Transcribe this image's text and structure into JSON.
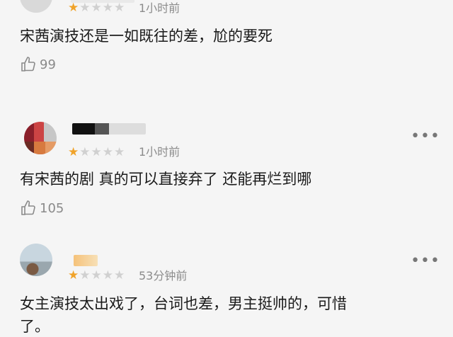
{
  "comments": [
    {
      "rating": 1,
      "time": "1小时前",
      "text": "宋茜演技还是一如既往的差，尬的要死",
      "likes": "99"
    },
    {
      "rating": 1,
      "time": "1小时前",
      "text": "有宋茜的剧 真的可以直接弃了 还能再烂到哪",
      "likes": "105"
    },
    {
      "rating": 1,
      "time": "53分钟前",
      "text": "女主演技太出戏了，台词也差，男主挺帅的，可惜",
      "text_line2": "了。"
    }
  ],
  "icons": {
    "like": "thumbs-up-icon",
    "more": "more-dots-icon",
    "star": "star-icon"
  },
  "colors": {
    "star_on": "#f0a32a",
    "star_off": "#d0d0d0",
    "muted": "#8c8c8c"
  },
  "more_glyph": "•••"
}
